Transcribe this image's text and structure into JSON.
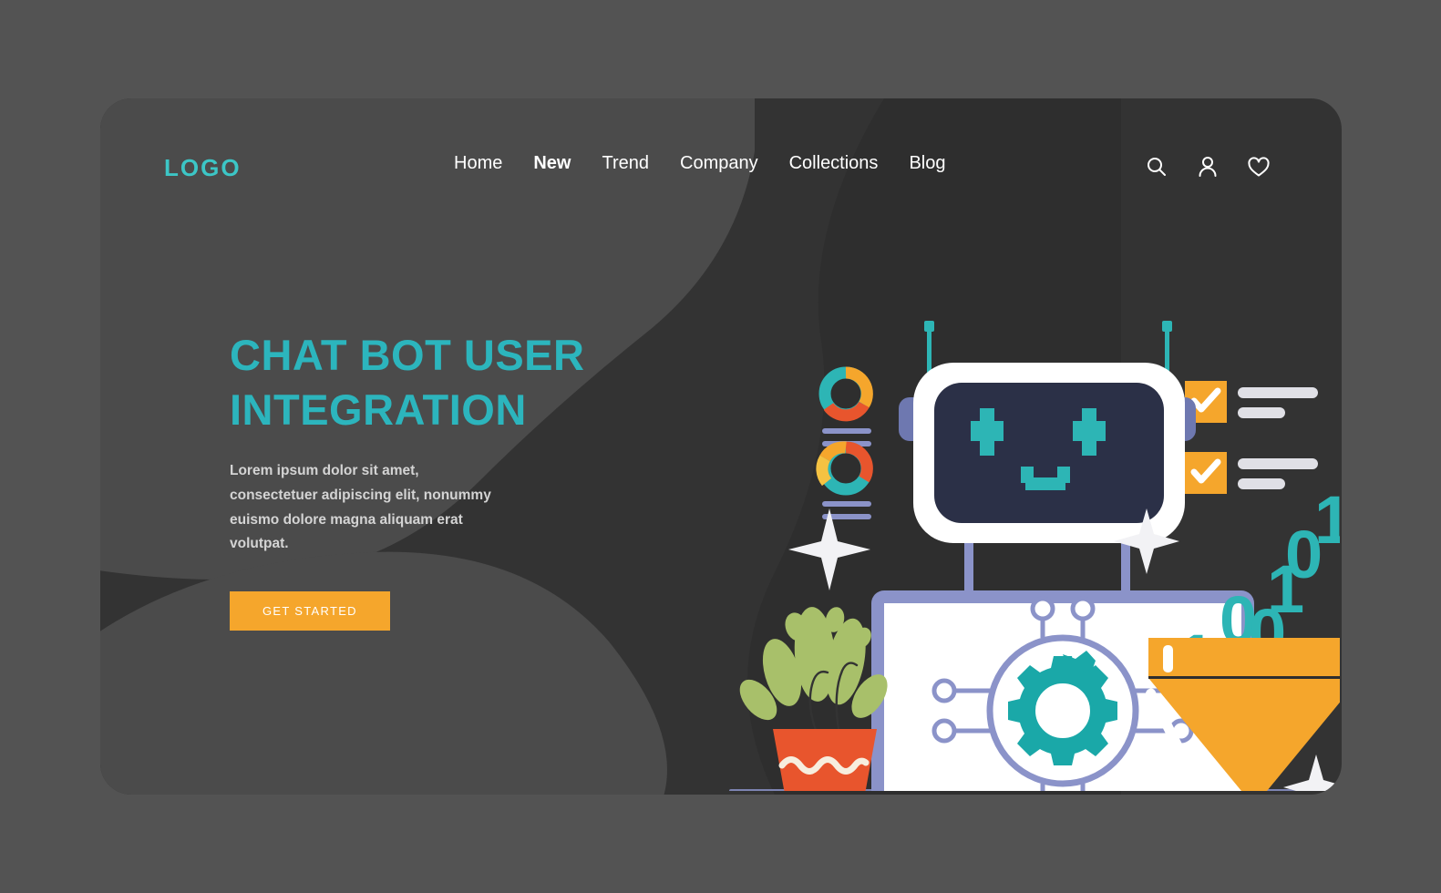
{
  "brand": {
    "logo": "LOGO",
    "accent": "#3cc6c6"
  },
  "nav": {
    "items": [
      {
        "label": "Home",
        "active": false
      },
      {
        "label": "New",
        "active": true
      },
      {
        "label": "Trend",
        "active": false
      },
      {
        "label": "Company",
        "active": false
      },
      {
        "label": "Collections",
        "active": false
      },
      {
        "label": "Blog",
        "active": false
      }
    ]
  },
  "header_icons": [
    {
      "name": "search-icon"
    },
    {
      "name": "user-icon"
    },
    {
      "name": "heart-icon"
    }
  ],
  "hero": {
    "headline_line1": "CHAT BOT USER",
    "headline_line2": "INTEGRATION",
    "headline_color": "#2cb5bd",
    "body": "Lorem ipsum dolor sit amet, consectetuer adipiscing elit, nonummy euismo dolore magna aliquam erat volutpat.",
    "cta_label": "GET STARTED",
    "cta_color": "#f5a62c"
  },
  "illustration": {
    "binary_digits": [
      "1",
      "0",
      "1",
      "0",
      "1",
      "0"
    ],
    "colors": {
      "teal": "#2db5b5",
      "orange": "#f5a62c",
      "orange_dark": "#d98e1f",
      "periwinkle": "#8b93c9",
      "screen_navy": "#2b3047",
      "white": "#ffffff",
      "plant_green": "#a8c06a",
      "pot_red": "#e8552d",
      "bar_gray": "#e0e0e6"
    },
    "checklist": [
      {
        "checked": true
      },
      {
        "checked": true
      }
    ],
    "donut_charts": 2
  },
  "page": {
    "background": "#535353",
    "card_background": "#333333"
  }
}
